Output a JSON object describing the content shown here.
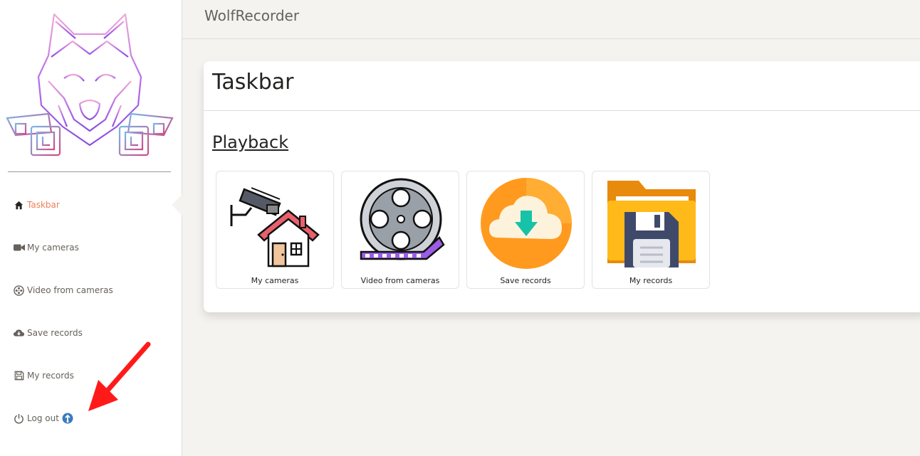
{
  "app": {
    "title": "WolfRecorder"
  },
  "sidebar": {
    "items": [
      {
        "label": "Taskbar",
        "icon": "home-icon",
        "active": true
      },
      {
        "label": "My cameras",
        "icon": "video-camera-icon"
      },
      {
        "label": "Video from cameras",
        "icon": "film-reel-icon"
      },
      {
        "label": "Save records",
        "icon": "cloud-download-icon"
      },
      {
        "label": "My records",
        "icon": "floppy-disk-icon"
      },
      {
        "label": "Log out",
        "icon": "power-icon"
      }
    ]
  },
  "card": {
    "title": "Taskbar",
    "section": "Playback",
    "tiles": [
      {
        "label": "My cameras",
        "icon": "camera-house-icon"
      },
      {
        "label": "Video from cameras",
        "icon": "film-reel-icon"
      },
      {
        "label": "Save records",
        "icon": "cloud-download-icon"
      },
      {
        "label": "My records",
        "icon": "folder-floppy-icon"
      }
    ]
  },
  "colors": {
    "active": "#ef8157",
    "text": "#66615b",
    "annotation": "#ff1a1a"
  }
}
